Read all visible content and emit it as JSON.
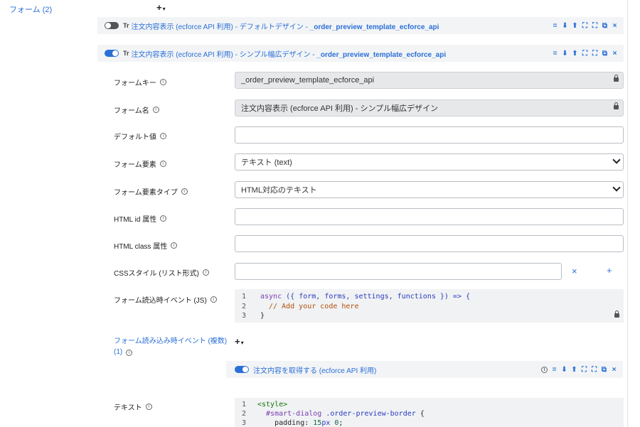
{
  "sidebar": {
    "title": "フォーム (2)"
  },
  "forms_add": {
    "plus": "+",
    "caret": "▾"
  },
  "bar1": {
    "tr": "Tr",
    "title_prefix": "注文内容表示 (ecforce API 利用) - デフォルトデザイン - ",
    "title_key": "_order_preview_template_ecforce_api",
    "enabled": false
  },
  "bar2": {
    "tr": "Tr",
    "title_prefix": "注文内容表示 (ecforce API 利用) - シンプル幅広デザイン - ",
    "title_key": "_order_preview_template_ecforce_api",
    "enabled": true
  },
  "toolbar_icons": {
    "menu": "=",
    "down": "⬇",
    "up": "⬆",
    "compress": "⛶",
    "expand": "⛶",
    "copy": "⧉",
    "close": "×"
  },
  "fields": {
    "form_key": {
      "label": "フォームキー",
      "value": "_order_preview_template_ecforce_api"
    },
    "form_name": {
      "label": "フォーム名",
      "value": "注文内容表示 (ecforce API 利用) - シンプル幅広デザイン"
    },
    "default_value": {
      "label": "デフォルト値",
      "value": ""
    },
    "form_element": {
      "label": "フォーム要素",
      "value": "テキスト (text)"
    },
    "form_element_type": {
      "label": "フォーム要素タイプ",
      "value": "HTML対応のテキスト"
    },
    "html_id": {
      "label": "HTML id 属性",
      "value": ""
    },
    "html_class": {
      "label": "HTML class 属性",
      "value": ""
    },
    "css_style": {
      "label": "CSSスタイル (リスト形式)",
      "value": "",
      "clear": "×",
      "add": "+"
    },
    "load_event": {
      "label": "フォーム読込時イベント (JS)",
      "lines": [
        "1",
        "2",
        "3"
      ],
      "code_l1_kw": "async",
      "code_l1_rest": " ({ form, forms, settings, functions }) => {",
      "code_l2": "  // Add your code here",
      "code_l3": "}"
    },
    "load_events_multi": {
      "label": "フォーム読み込み時イベント (複数) (1)",
      "plus": "+",
      "caret": "▾"
    },
    "sub_event": {
      "title": "注文内容を取得する (ecforce API 利用)",
      "enabled": true
    },
    "text": {
      "label": "テキスト",
      "lines": [
        "1",
        "2",
        "3"
      ],
      "code_l1": "<style>",
      "code_l2_sel1": "  #smart-dialog",
      "code_l2_sel2": " .order-preview-border",
      "code_l2_rest": " {",
      "code_l3_prop": "    padding: ",
      "code_l3_num": "15",
      "code_l3_unit": "px ",
      "code_l3_num2": "0",
      "code_l3_end": ";"
    }
  },
  "colors": {
    "accent": "#2b6fd6",
    "bar_bg": "#f2f4f6",
    "locked_bg": "#e6e8ea"
  }
}
